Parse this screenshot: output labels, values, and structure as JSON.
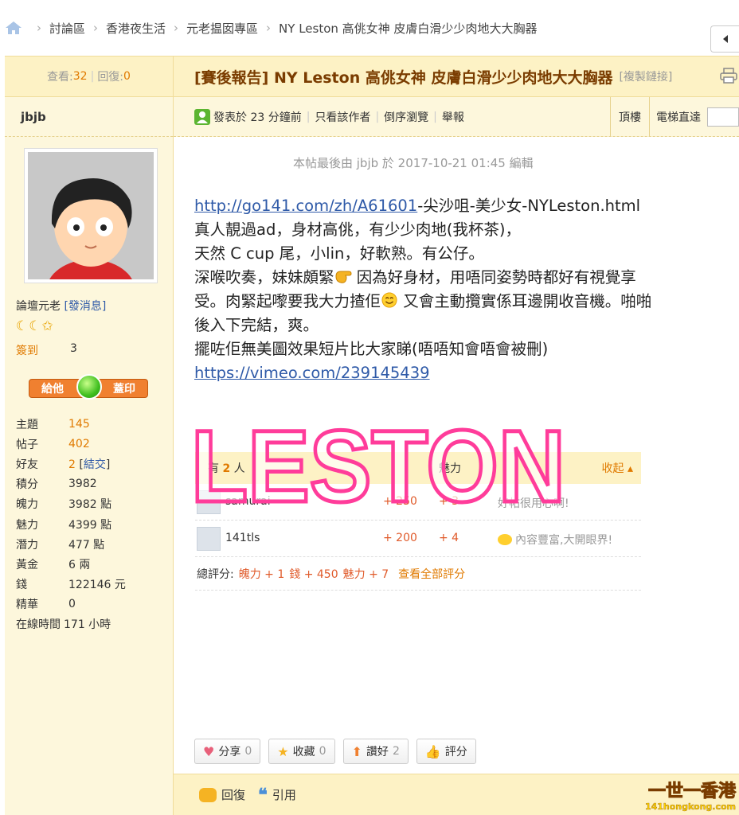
{
  "breadcrumb": {
    "items": [
      "討論區",
      "香港夜生活",
      "元老揾囡專區",
      "NY Leston 高佻女神 皮膚白滑少少肉地大大胸器"
    ]
  },
  "thread": {
    "views_label": "查看:",
    "views": "32",
    "replies_label": "回復:",
    "replies": "0",
    "title": "[賽後報告] NY Leston 高佻女神 皮膚白滑少少肉地大大胸器",
    "copy_link": "[複製鏈接]"
  },
  "author": {
    "name": "jbjb",
    "rank": "論壇元老",
    "pm": "[發消息]",
    "stars": "☾☾✩",
    "checkin_label": "簽到",
    "checkin_value": "3",
    "stamp_left": "給他",
    "stamp_right": "蓋印",
    "stats": [
      {
        "k": "主題",
        "v": "145"
      },
      {
        "k": "帖子",
        "v": "402"
      },
      {
        "k": "好友",
        "v": "2",
        "extra": "結交"
      },
      {
        "k": "積分",
        "v": "3982"
      },
      {
        "k": "魄力",
        "v": "3982 點"
      },
      {
        "k": "魅力",
        "v": "4399 點"
      },
      {
        "k": "潛力",
        "v": "477 點"
      },
      {
        "k": "黃金",
        "v": "6 兩"
      },
      {
        "k": "錢",
        "v": "122146 元"
      },
      {
        "k": "精華",
        "v": "0"
      },
      {
        "k": "在線時間",
        "v": "171 小時"
      }
    ]
  },
  "postmeta": {
    "posted": "發表於 23 分鐘前",
    "only_author": "只看該作者",
    "reverse": "倒序瀏覽",
    "report": "舉報",
    "top": "頂樓",
    "elevator": "電梯直達"
  },
  "post": {
    "edited": "本帖最後由 jbjb 於 2017-10-21 01:45 編輯",
    "link1": "http://go141.com/zh/A61601",
    "after_link1": "-尖沙咀-美少女-NYLeston.html",
    "line2": "真人靚過ad，身材高佻，有少少肉地(我杯茶)，",
    "line3": "天然 C cup 尾，小lin，好軟熟。有公仔。",
    "line4a": "深喉吹奏，妹妹頗緊",
    "line4b": " 因為好身材，用唔同姿勢時都好有視覺享受。肉緊起嚟要我大力揸佢",
    "line4c": " 又會主動攬實係耳邊開收音機。啪啪後入下完結，爽。",
    "line5": "擺咗佢無美圖效果短片比大家睇(唔唔知會唔會被刪)",
    "link2": "https://vimeo.com/239145439"
  },
  "rating": {
    "header_prefix": "有",
    "header_count": "2",
    "header_suffix": "人",
    "col_charm": "魅力",
    "collapse": "收起",
    "rows": [
      {
        "name": "samurai",
        "gold": "+ 250",
        "charm": "+ 3",
        "reason": "好帖很用心啊!"
      },
      {
        "name": "141tls",
        "gold": "+ 200",
        "charm": "+ 4",
        "reason": "內容豐富,大開眼界!"
      }
    ],
    "total_label": "總評分:",
    "total1": "魄力 + 1",
    "total2": "錢 + 450",
    "total3": "魅力 + 7",
    "view_all": "查看全部評分"
  },
  "watermark": "LESTON",
  "actions": [
    {
      "label": "分享",
      "count": "0",
      "icon": "heart-icon"
    },
    {
      "label": "收藏",
      "count": "0",
      "icon": "star-icon"
    },
    {
      "label": "讚好",
      "count": "2",
      "icon": "up-arrow-icon"
    },
    {
      "label": "評分",
      "count": "",
      "icon": "thumb-icon"
    }
  ],
  "reply": {
    "reply": "回復",
    "quote": "引用"
  },
  "site_logo": {
    "line1": "一世一香港",
    "line2": "141hongkong.com"
  },
  "colors": {
    "accent": "#e07a00",
    "title": "#7a3c00",
    "link": "#2f5aa8",
    "watermark": "#ff3c9a"
  }
}
